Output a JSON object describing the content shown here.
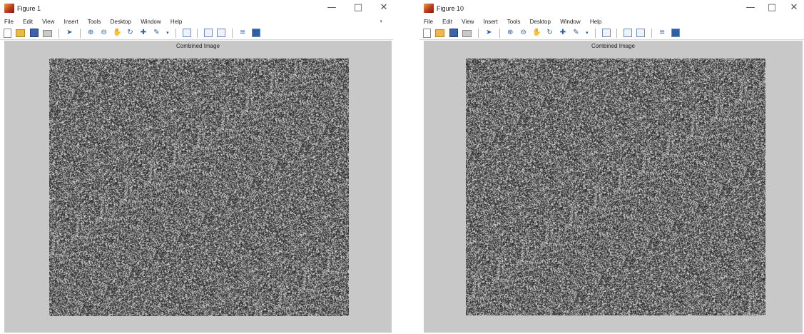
{
  "windows": [
    {
      "title": "Figure 1",
      "menu": [
        "File",
        "Edit",
        "View",
        "Insert",
        "Tools",
        "Desktop",
        "Window",
        "Help"
      ],
      "axes_title": "Combined Image",
      "controls": {
        "minimize": "—",
        "maximize": "□",
        "close": "✕"
      }
    },
    {
      "title": "Figure 10",
      "menu": [
        "File",
        "Edit",
        "View",
        "Insert",
        "Tools",
        "Desktop",
        "Window",
        "Help"
      ],
      "axes_title": "Combined Image",
      "controls": {
        "minimize": "—",
        "maximize": "□",
        "close": "✕"
      }
    }
  ],
  "toolbar_icons": [
    "new-figure-icon",
    "open-file-icon",
    "save-icon",
    "print-icon",
    "edit-plot-icon",
    "zoom-in-icon",
    "zoom-out-icon",
    "pan-icon",
    "rotate-3d-icon",
    "data-cursor-icon",
    "brush-icon",
    "link-plot-icon",
    "insert-colorbar-icon",
    "insert-legend-icon",
    "hide-plot-tools-icon",
    "show-plot-tools-icon"
  ],
  "colors": {
    "figure_background": "#c8c8c8",
    "noise_dark": "#1a1a1a",
    "noise_light": "#f0f0f0"
  }
}
